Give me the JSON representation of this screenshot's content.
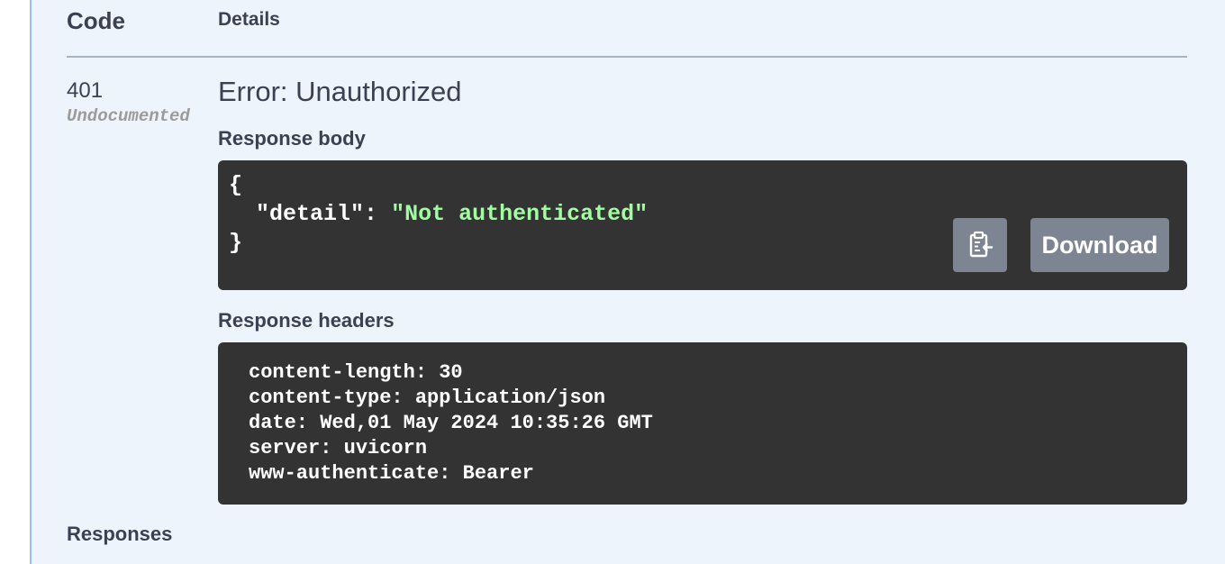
{
  "table": {
    "header_code": "Code",
    "header_details": "Details"
  },
  "response": {
    "status_code": "401",
    "undocumented_label": "Undocumented",
    "error_title": "Error: Unauthorized",
    "body_label": "Response body",
    "body_json": {
      "open_brace": "{",
      "key": "\"detail\"",
      "colon": ": ",
      "value": "\"Not authenticated\"",
      "close_brace": "}"
    },
    "copy_button_icon": "clipboard-icon",
    "download_label": "Download",
    "headers_label": "Response headers",
    "headers": [
      "content-length: 30",
      "content-type: application/json",
      "date: Wed,01 May 2024 10:35:26 GMT",
      "server: uvicorn",
      "www-authenticate: Bearer"
    ]
  },
  "responses_label": "Responses",
  "colors": {
    "panel_background": "#eef4fc",
    "panel_border": "#9dbfe9",
    "code_background": "#333333",
    "json_string": "#a2fca2",
    "button_background": "#7d8492",
    "text": "#3b4151"
  }
}
